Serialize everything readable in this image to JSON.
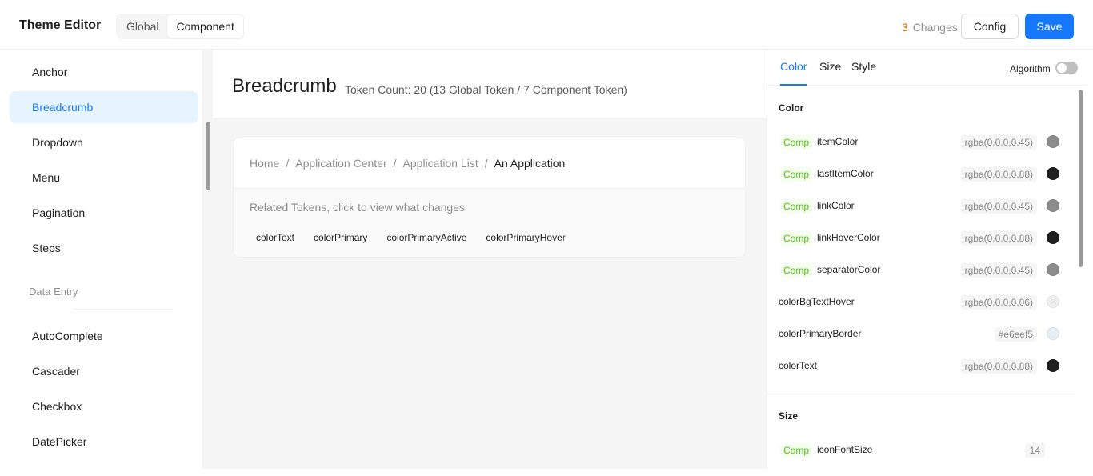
{
  "header": {
    "title": "Theme Editor",
    "segment": {
      "items": [
        "Global",
        "Component"
      ],
      "selected": "Component"
    },
    "changes_count": "3",
    "changes_label": "Changes",
    "config_label": "Config",
    "save_label": "Save"
  },
  "sidebar": {
    "items": [
      {
        "label": "Anchor"
      },
      {
        "label": "Breadcrumb",
        "selected": true
      },
      {
        "label": "Dropdown"
      },
      {
        "label": "Menu"
      },
      {
        "label": "Pagination"
      },
      {
        "label": "Steps"
      }
    ],
    "group_label": "Data Entry",
    "group_items": [
      {
        "label": "AutoComplete"
      },
      {
        "label": "Cascader"
      },
      {
        "label": "Checkbox"
      },
      {
        "label": "DatePicker"
      }
    ]
  },
  "main": {
    "component_title": "Breadcrumb",
    "token_count": "Token Count: 20 (13 Global Token / 7 Component Token)",
    "breadcrumb": [
      "Home",
      "Application Center",
      "Application List",
      "An Application"
    ],
    "separator": "/",
    "related_label": "Related Tokens, click to view what changes",
    "related_tokens": [
      "colorText",
      "colorPrimary",
      "colorPrimaryActive",
      "colorPrimaryHover"
    ]
  },
  "panel": {
    "tabs": [
      "Color",
      "Size",
      "Style"
    ],
    "active_tab": "Color",
    "algorithm_label": "Algorithm",
    "algorithm_on": false,
    "color_section_title": "Color",
    "comp_badge": "Comp",
    "color_tokens": [
      {
        "name": "itemColor",
        "comp": true,
        "value": "rgba(0,0,0,0.45)",
        "swatch": "#8c8c8c"
      },
      {
        "name": "lastItemColor",
        "comp": true,
        "value": "rgba(0,0,0,0.88)",
        "swatch": "#1f1f1f"
      },
      {
        "name": "linkColor",
        "comp": true,
        "value": "rgba(0,0,0,0.45)",
        "swatch": "#8c8c8c"
      },
      {
        "name": "linkHoverColor",
        "comp": true,
        "value": "rgba(0,0,0,0.88)",
        "swatch": "#1f1f1f"
      },
      {
        "name": "separatorColor",
        "comp": true,
        "value": "rgba(0,0,0,0.45)",
        "swatch": "#8c8c8c"
      },
      {
        "name": "colorBgTextHover",
        "comp": false,
        "value": "rgba(0,0,0,0.06)",
        "swatch": "transparent"
      },
      {
        "name": "colorPrimaryBorder",
        "comp": false,
        "value": "#e6eef5",
        "swatch": "#e6eef5"
      },
      {
        "name": "colorText",
        "comp": false,
        "value": "rgba(0,0,0,0.88)",
        "swatch": "#1f1f1f"
      }
    ],
    "size_section_title": "Size",
    "size_tokens": [
      {
        "name": "iconFontSize",
        "comp": true,
        "value": "14"
      }
    ]
  }
}
